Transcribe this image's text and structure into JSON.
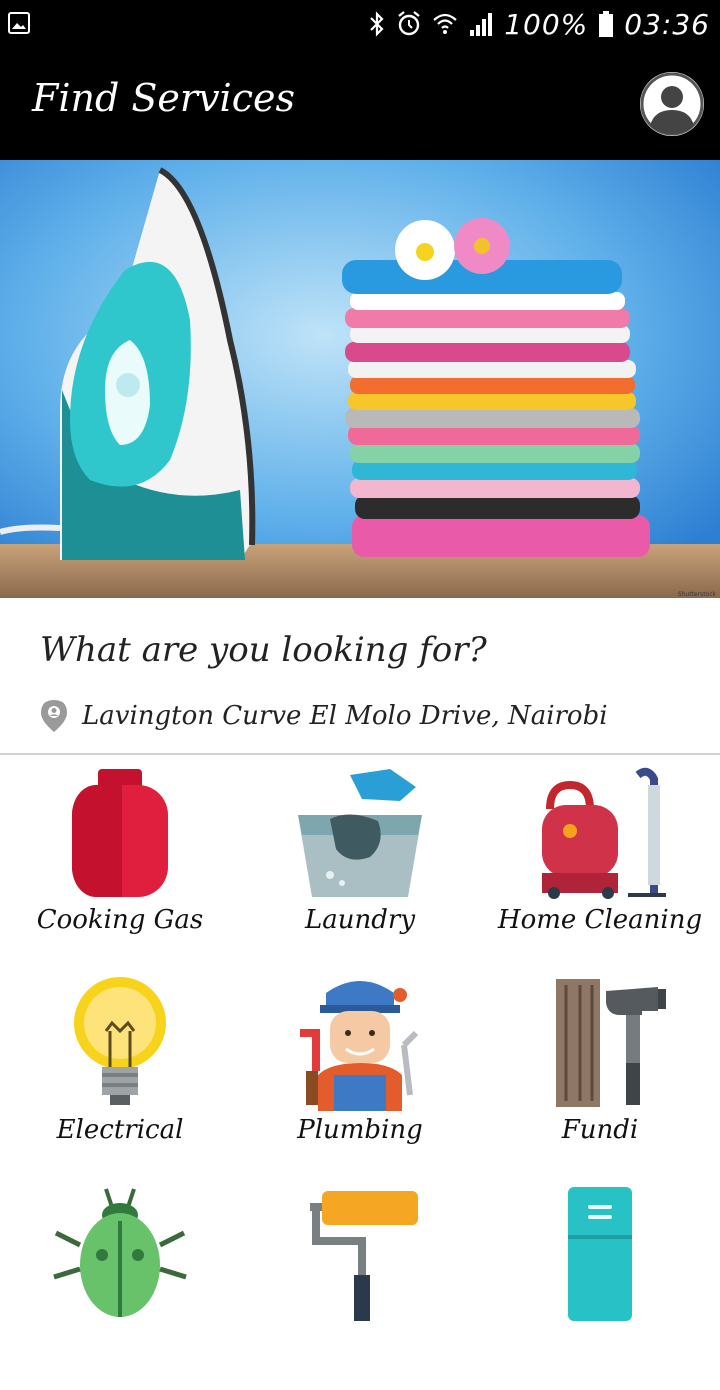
{
  "status": {
    "battery_pct": "100%",
    "time": "03:36"
  },
  "appbar": {
    "title": "Find Services"
  },
  "hero": {
    "credit": "Shutterstock"
  },
  "search": {
    "question": "What are you looking for?",
    "location": "Lavington Curve El Molo Drive, Nairobi"
  },
  "services": [
    {
      "label": "Cooking Gas",
      "icon": "gas-cylinder-icon"
    },
    {
      "label": "Laundry",
      "icon": "laundry-basin-icon"
    },
    {
      "label": "Home Cleaning",
      "icon": "vacuum-cleaner-icon"
    },
    {
      "label": "Electrical",
      "icon": "light-bulb-icon"
    },
    {
      "label": "Plumbing",
      "icon": "plumber-icon"
    },
    {
      "label": "Fundi",
      "icon": "hammer-icon"
    },
    {
      "label": "",
      "icon": "bug-icon"
    },
    {
      "label": "",
      "icon": "paint-roller-icon"
    },
    {
      "label": "",
      "icon": "fridge-icon"
    }
  ]
}
